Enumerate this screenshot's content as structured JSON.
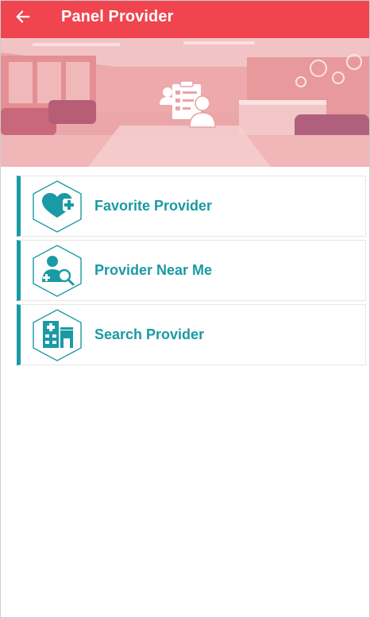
{
  "header": {
    "title": "Panel Provider",
    "back_icon": "arrow-left-icon",
    "color": "#f0454f"
  },
  "banner": {
    "icon": "provider-list-icon",
    "tint": "#f0454f"
  },
  "menu": {
    "accent": "#1a9aa5",
    "items": [
      {
        "label": "Favorite Provider",
        "icon": "heart-plus-icon"
      },
      {
        "label": "Provider Near Me",
        "icon": "doctor-search-icon"
      },
      {
        "label": "Search Provider",
        "icon": "hospital-building-icon"
      }
    ]
  }
}
